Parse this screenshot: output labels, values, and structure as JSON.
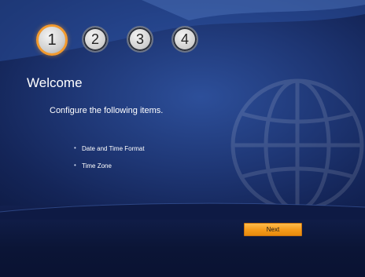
{
  "wizard": {
    "steps": [
      "1",
      "2",
      "3",
      "4"
    ],
    "active_step": 1,
    "title": "Welcome",
    "description": "Configure the following items.",
    "items": [
      "Date and Time Format",
      "Time Zone"
    ],
    "next_label": "Next"
  },
  "colors": {
    "accent": "#f29a2e",
    "background": "#1e3674",
    "text": "#ffffff"
  }
}
